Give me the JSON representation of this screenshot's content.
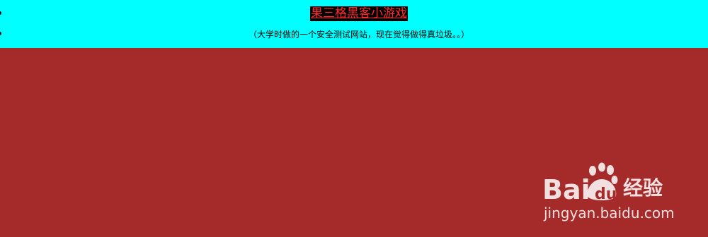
{
  "header": {
    "title_link": "果三格黑客小游戏",
    "note": "（大学时做的一个安全测试网站，现在觉得做得真垃圾。。）"
  },
  "watermark": {
    "logo_text": "Bai经验",
    "url": "jingyan.baidu.com"
  },
  "colors": {
    "header_bg": "#00ffff",
    "page_bg": "#a52a2a",
    "title_bg": "#000000",
    "title_text": "#ff2a2a"
  }
}
